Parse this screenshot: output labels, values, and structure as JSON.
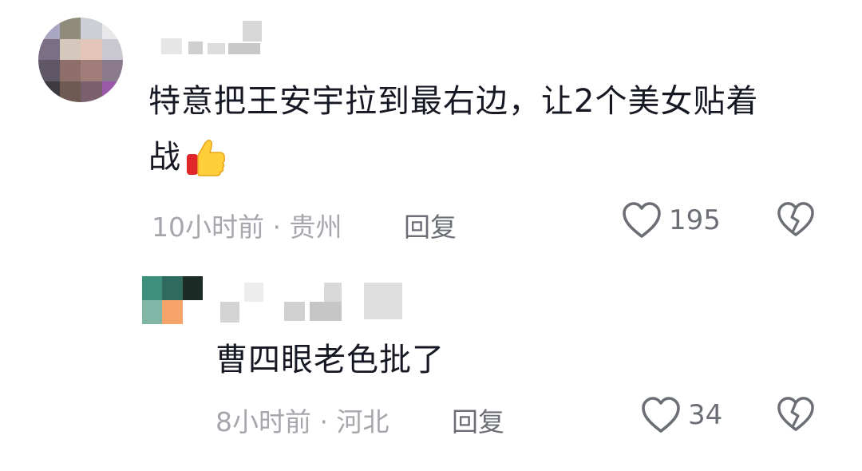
{
  "comments": [
    {
      "text_line1": "特意把王安宇拉到最右边，让2个美女贴着",
      "text_line2": "战",
      "emoji": "thumbs-up-emoji",
      "meta": "10小时前 · 贵州",
      "reply_label": "回复",
      "likes": "195"
    },
    {
      "text": "曹四眼老色批了",
      "meta": "8小时前 · 河北",
      "reply_label": "回复",
      "likes": "34"
    }
  ],
  "colors": {
    "text": "#161823",
    "meta": "#a5a7ad",
    "icon": "#6b6e75",
    "background": "#ffffff"
  },
  "icons": [
    "heart-outline-icon",
    "broken-heart-icon",
    "thumbs-up-emoji"
  ]
}
